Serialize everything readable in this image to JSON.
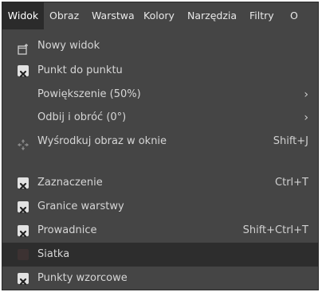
{
  "menubar": {
    "items": [
      {
        "label": "Widok",
        "active": true
      },
      {
        "label": "Obraz"
      },
      {
        "label": "Warstwa"
      },
      {
        "label": "Kolory"
      },
      {
        "label": "Narzędzia"
      },
      {
        "label": "Filtry"
      },
      {
        "label": "O"
      }
    ]
  },
  "menu": {
    "new_view": {
      "label": "Nowy widok",
      "icon": "new-view-icon"
    },
    "dot_for_dot": {
      "label": "Punkt do punktu",
      "checked": true
    },
    "zoom": {
      "label": "Powiększenie (50%)",
      "submenu_arrow": "›"
    },
    "flip_rotate": {
      "label": "Odbij i obróć (0°)",
      "submenu_arrow": "›"
    },
    "center_image": {
      "label": "Wyśrodkuj obraz w oknie",
      "shortcut": "Shift+J",
      "icon": "center-icon"
    },
    "selection": {
      "label": "Zaznaczenie",
      "shortcut": "Ctrl+T",
      "checked": true
    },
    "layer_boundary": {
      "label": "Granice warstwy",
      "checked": true
    },
    "guides": {
      "label": "Prowadnice",
      "shortcut": "Shift+Ctrl+T",
      "checked": true
    },
    "grid": {
      "label": "Siatka",
      "checked": false,
      "highlighted": true
    },
    "sample_points": {
      "label": "Punkty wzorcowe",
      "checked": true
    }
  },
  "colors": {
    "menu_bg": "#454545",
    "highlight_bg": "#2d2d2d",
    "text": "#d6d6d6",
    "check_bg": "#e2e2e2"
  }
}
